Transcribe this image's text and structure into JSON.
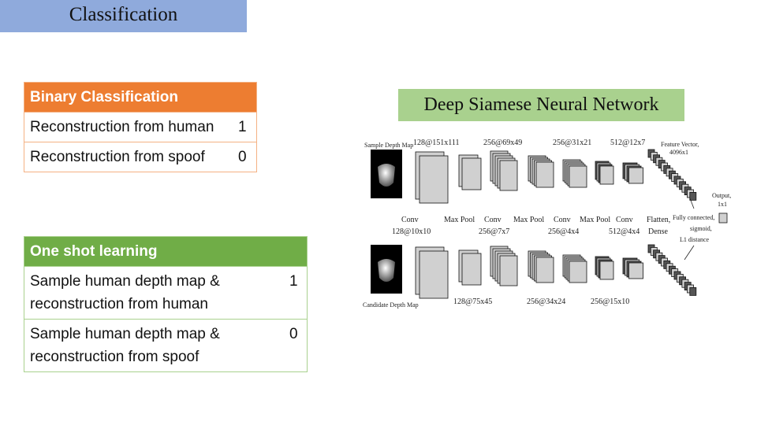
{
  "header": {
    "title": "Classification"
  },
  "binary_table": {
    "header": "Binary Classification",
    "rows": [
      {
        "label": "Reconstruction from human",
        "value": "1"
      },
      {
        "label": "Reconstruction from spoof",
        "value": "0"
      }
    ],
    "color": "#ed7d31"
  },
  "oneshot_table": {
    "header": "One shot learning",
    "rows": [
      {
        "label": "Sample human depth map & reconstruction from human",
        "value": "1"
      },
      {
        "label": "Sample human depth map & reconstruction from spoof",
        "value": "0"
      }
    ],
    "color": "#70ad47"
  },
  "network": {
    "title": "Deep Siamese Neural Network",
    "sample_label": "Sample Depth Map",
    "candidate_label": "Candidate Depth Map",
    "top_dims": [
      "128@151x111",
      "256@69x49",
      "256@31x21",
      "512@12x7"
    ],
    "feature_vector": [
      "Feature Vector,",
      "4096x1"
    ],
    "output": [
      "Output,",
      "1x1"
    ],
    "ops": [
      "Conv",
      "Max Pool",
      "Conv",
      "Max Pool",
      "Conv",
      "Max Pool",
      "Conv",
      "Flatten,"
    ],
    "kernels": [
      "128@10x10",
      "256@7x7",
      "256@4x4",
      "512@4x4",
      "Dense"
    ],
    "fc": [
      "Fully connected,",
      "sigmoid,",
      "L1 distance"
    ],
    "bottom_dims": [
      "128@75x45",
      "256@34x24",
      "256@15x10"
    ]
  }
}
